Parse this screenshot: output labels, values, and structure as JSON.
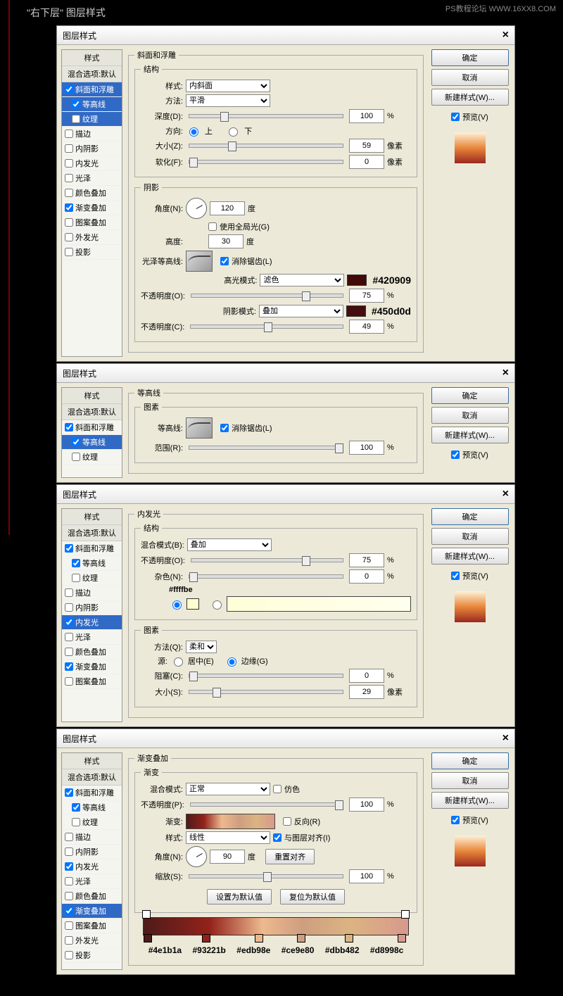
{
  "page": {
    "title": "\"右下层\" 图层样式",
    "watermark": "PS教程论坛 WWW.16XX8.COM"
  },
  "common": {
    "dialog_title": "图层样式",
    "ok": "确定",
    "cancel": "取消",
    "new_style": "新建样式(W)...",
    "preview": "预览(V)",
    "antialias": "消除锯齿(L)"
  },
  "sidebar_header": {
    "styles": "样式",
    "blend": "混合选项:默认"
  },
  "styles": {
    "bevel": "斜面和浮雕",
    "contour": "等高线",
    "texture": "纹理",
    "stroke": "描边",
    "inner_shadow": "内阴影",
    "inner_glow": "内发光",
    "satin": "光泽",
    "color_overlay": "颜色叠加",
    "gradient_overlay": "渐变叠加",
    "pattern_overlay": "图案叠加",
    "outer_glow": "外发光",
    "drop_shadow": "投影"
  },
  "bevel": {
    "section": "斜面和浮雕",
    "structure": "结构",
    "shadow_group": "阴影",
    "style_label": "样式:",
    "style_val": "内斜面",
    "tech_label": "方法:",
    "tech_val": "平滑",
    "depth_label": "深度(D):",
    "depth_val": "100",
    "pct": "%",
    "dir_label": "方向:",
    "dir_up": "上",
    "dir_down": "下",
    "size_label": "大小(Z):",
    "size_val": "59",
    "px": "像素",
    "soften_label": "软化(F):",
    "soften_val": "0",
    "angle_label": "角度(N):",
    "angle_val": "120",
    "deg": "度",
    "global": "使用全局光(G)",
    "alt_label": "高度:",
    "alt_val": "30",
    "gloss_label": "光泽等高线:",
    "hmode_label": "高光模式:",
    "hmode_val": "滤色",
    "hcolor": "#420909",
    "hhex": "#420909",
    "hopacity_label": "不透明度(O):",
    "hopacity_val": "75",
    "smode_label": "阴影模式:",
    "smode_val": "叠加",
    "scolor": "#450d0d",
    "shex": "#450d0d",
    "sopacity_label": "不透明度(C):",
    "sopacity_val": "49"
  },
  "contour_panel": {
    "section": "等高线",
    "elements": "图素",
    "contour_label": "等高线:",
    "range_label": "范围(R):",
    "range_val": "100",
    "pct": "%"
  },
  "inner_glow": {
    "section": "内发光",
    "structure": "结构",
    "elements": "图素",
    "blend_label": "混合模式(B):",
    "blend_val": "叠加",
    "opacity_label": "不透明度(O):",
    "opacity_val": "75",
    "pct": "%",
    "noise_label": "杂色(N):",
    "noise_val": "0",
    "color_hex": "#ffffbe",
    "tech_label": "方法(Q):",
    "tech_val": "柔和",
    "source_label": "源:",
    "source_center": "居中(E)",
    "source_edge": "边缘(G)",
    "choke_label": "阻塞(C):",
    "choke_val": "0",
    "size_label": "大小(S):",
    "size_val": "29",
    "px": "像素"
  },
  "gradient": {
    "section": "渐变叠加",
    "group": "渐变",
    "blend_label": "混合模式:",
    "blend_val": "正常",
    "dither": "仿色",
    "opacity_label": "不透明度(P):",
    "opacity_val": "100",
    "pct": "%",
    "grad_label": "渐变:",
    "reverse": "反向(R)",
    "style_label": "样式:",
    "style_val": "线性",
    "align": "与图层对齐(I)",
    "angle_label": "角度(N):",
    "angle_val": "90",
    "deg": "度",
    "reset_align": "重置对齐",
    "scale_label": "缩放(S):",
    "scale_val": "100",
    "set_default": "设置为默认值",
    "reset_default": "复位为默认值",
    "stops": [
      "#4e1b1a",
      "#93221b",
      "#edb98e",
      "#ce9e80",
      "#dbb482",
      "#d8998c"
    ]
  }
}
